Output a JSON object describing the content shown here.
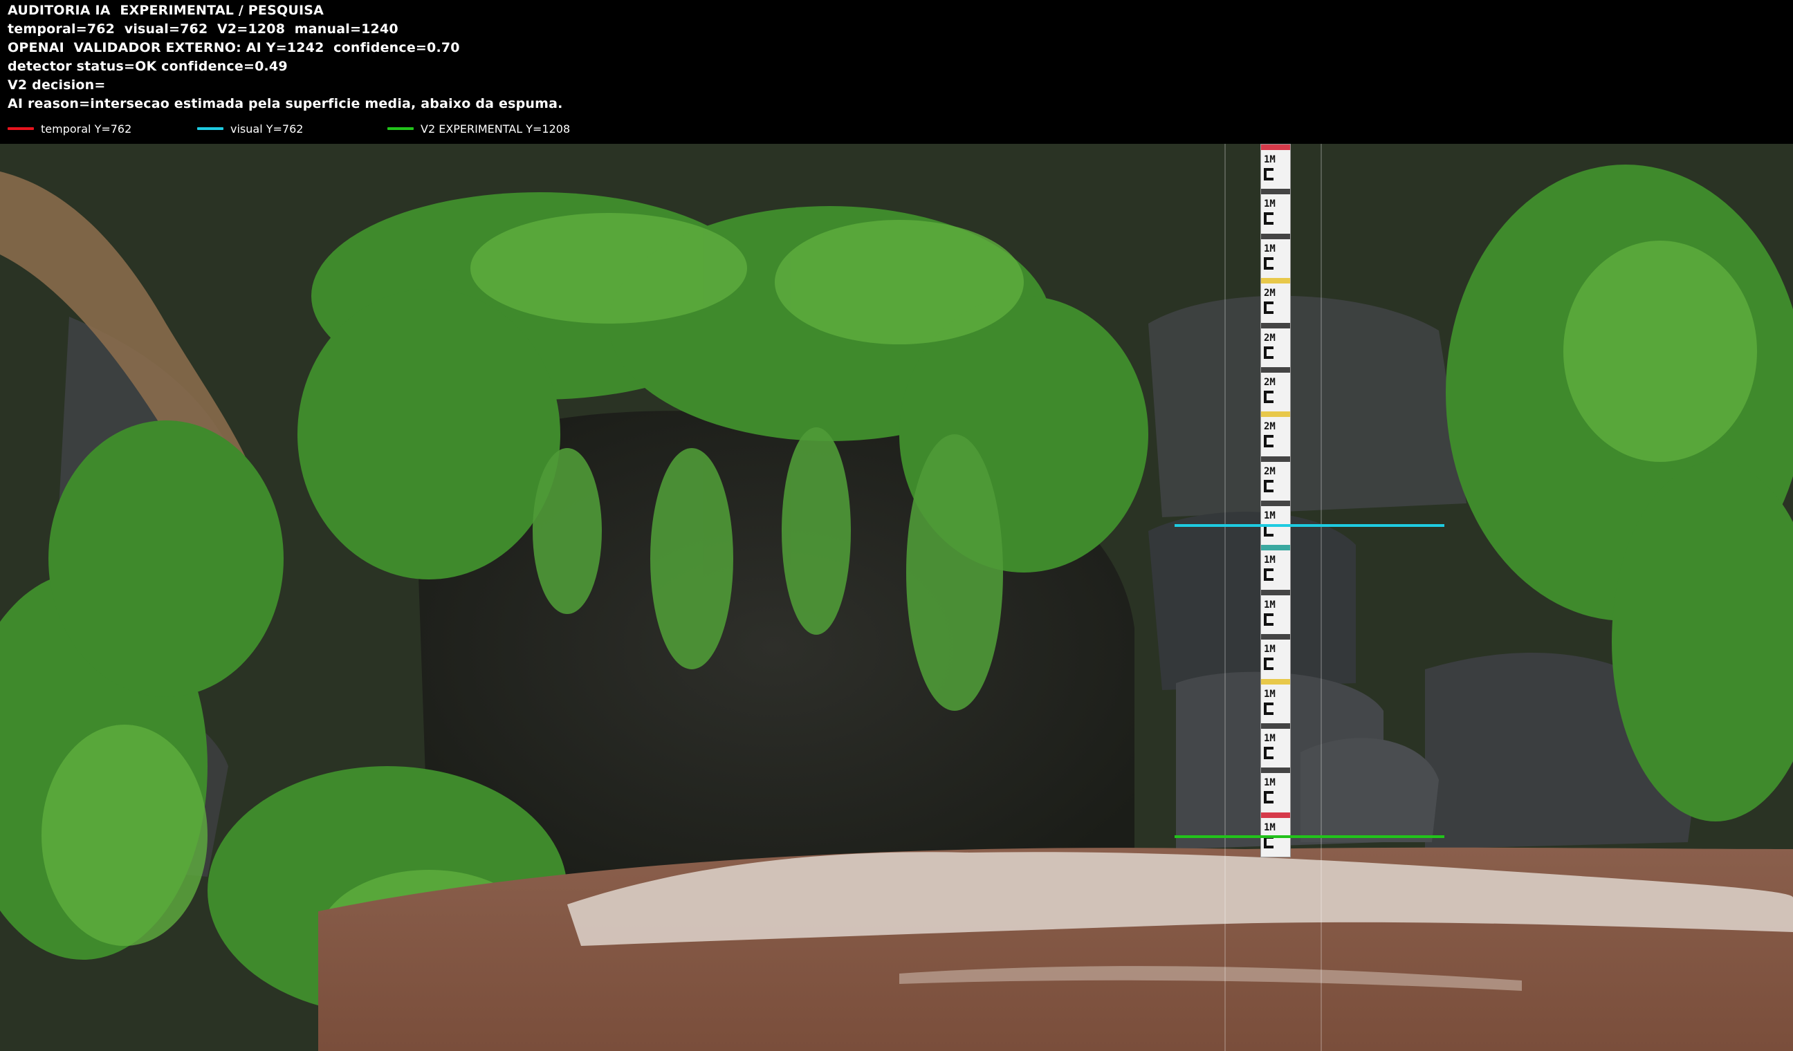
{
  "header": {
    "lines": [
      "AUDITORIA IA  EXPERIMENTAL / PESQUISA",
      "temporal=762  visual=762  V2=1208  manual=1240",
      "OPENAI  VALIDADOR EXTERNO: AI Y=1242  confidence=0.70",
      "detector status=OK confidence=0.49",
      "V2 decision=",
      "AI reason=intersecao estimada pela superficie media, abaixo da espuma."
    ]
  },
  "legend": [
    {
      "label": "temporal Y=762",
      "color": "#e8141e"
    },
    {
      "label": "visual Y=762",
      "color": "#1ecbe1"
    },
    {
      "label": "V2 EXPERIMENTAL Y=1208",
      "color": "#22c31b"
    }
  ],
  "overlay": {
    "visual_line_color": "#1ecbe1",
    "v2_line_color": "#22c31b"
  },
  "staff_gauge": {
    "marks": [
      "1M",
      "1M",
      "1M",
      "2M",
      "2M",
      "2M",
      "2M",
      "2M",
      "1M",
      "1M",
      "1M",
      "1M",
      "1M",
      "1M",
      "1M",
      "1M"
    ]
  }
}
